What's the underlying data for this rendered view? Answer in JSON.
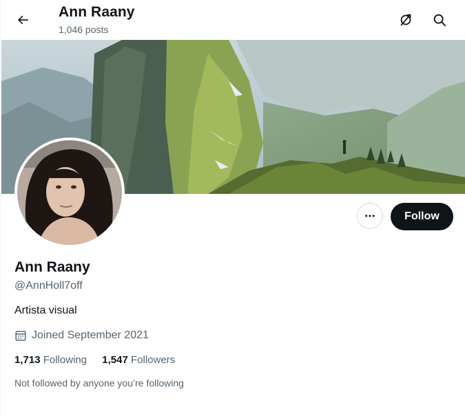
{
  "header": {
    "title": "Ann Raany",
    "posts_count": "1,046 posts"
  },
  "icons": {
    "back": "back-arrow-icon",
    "timeline_off": "timeline-off-icon",
    "search": "search-icon",
    "more": "more-dots-icon",
    "calendar": "calendar-icon"
  },
  "profile": {
    "name": "Ann Raany",
    "handle": "@AnnHoll7off",
    "bio": "Artista visual",
    "joined": "Joined September 2021",
    "following_count": "1,713",
    "following_label": "Following",
    "followers_count": "1,547",
    "followers_label": "Followers",
    "not_followed_note": "Not followed by anyone you’re following"
  },
  "actions": {
    "follow_label": "Follow"
  },
  "colors": {
    "text_primary": "#0f1419",
    "text_secondary": "#536471",
    "button_dark": "#0f1419",
    "border": "#cfd9de"
  }
}
